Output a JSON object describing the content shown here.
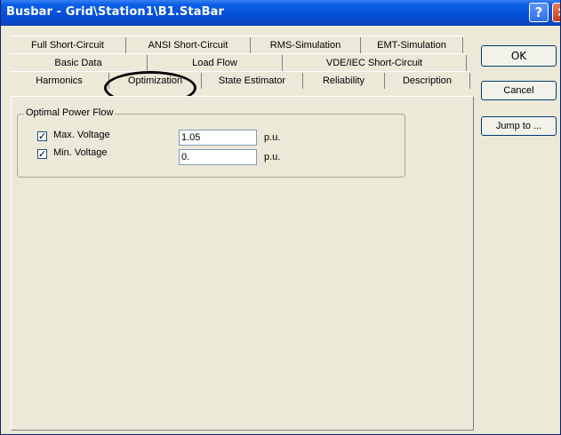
{
  "window": {
    "title": "Busbar - Grid\\Station1\\B1.StaBar",
    "help_glyph": "?",
    "close_glyph": "✕"
  },
  "tabs": {
    "row1": [
      "Full Short-Circuit",
      "ANSI Short-Circuit",
      "RMS-Simulation",
      "EMT-Simulation"
    ],
    "row2": [
      "Basic Data",
      "Load Flow",
      "VDE/IEC Short-Circuit"
    ],
    "row3": [
      "Harmonics",
      "Optimization",
      "State Estimator",
      "Reliability",
      "Description"
    ],
    "active": "Optimization"
  },
  "optimal_power_flow": {
    "group_label": "Optimal Power Flow",
    "max_voltage": {
      "label": "Max. Voltage",
      "checked": true,
      "value": "1.05",
      "unit": "p.u."
    },
    "min_voltage": {
      "label": "Min. Voltage",
      "checked": true,
      "value": "0.",
      "unit": "p.u."
    }
  },
  "buttons": {
    "ok": "OK",
    "cancel": "Cancel",
    "jump_to": "Jump to ..."
  },
  "annotation": {
    "highlight_tab": "Optimization",
    "shape": "ellipse",
    "color": "#000000"
  },
  "colors": {
    "titlebar": "#0450d8",
    "dialog_bg": "#ece9d8",
    "input_border": "#7f9db9"
  }
}
